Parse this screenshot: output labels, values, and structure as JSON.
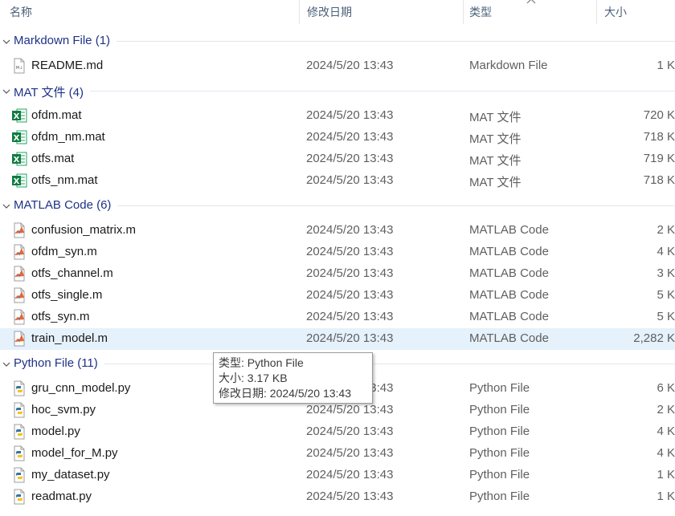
{
  "columns": {
    "name": "名称",
    "date": "修改日期",
    "type": "类型",
    "size": "大小"
  },
  "groups": [
    {
      "title": "Markdown File (1)",
      "files": [
        {
          "name": "README.md",
          "date": "2024/5/20 13:43",
          "type": "Markdown File",
          "size": "1 K",
          "icon": "markdown-file-icon"
        }
      ]
    },
    {
      "title": "MAT 文件 (4)",
      "files": [
        {
          "name": "ofdm.mat",
          "date": "2024/5/20 13:43",
          "type": "MAT 文件",
          "size": "720 K",
          "icon": "excel-mat-file-icon"
        },
        {
          "name": "ofdm_nm.mat",
          "date": "2024/5/20 13:43",
          "type": "MAT 文件",
          "size": "718 K",
          "icon": "excel-mat-file-icon"
        },
        {
          "name": "otfs.mat",
          "date": "2024/5/20 13:43",
          "type": "MAT 文件",
          "size": "719 K",
          "icon": "excel-mat-file-icon"
        },
        {
          "name": "otfs_nm.mat",
          "date": "2024/5/20 13:43",
          "type": "MAT 文件",
          "size": "718 K",
          "icon": "excel-mat-file-icon"
        }
      ]
    },
    {
      "title": "MATLAB Code (6)",
      "files": [
        {
          "name": "confusion_matrix.m",
          "date": "2024/5/20 13:43",
          "type": "MATLAB Code",
          "size": "2 K",
          "icon": "matlab-file-icon"
        },
        {
          "name": "ofdm_syn.m",
          "date": "2024/5/20 13:43",
          "type": "MATLAB Code",
          "size": "4 K",
          "icon": "matlab-file-icon"
        },
        {
          "name": "otfs_channel.m",
          "date": "2024/5/20 13:43",
          "type": "MATLAB Code",
          "size": "3 K",
          "icon": "matlab-file-icon"
        },
        {
          "name": "otfs_single.m",
          "date": "2024/5/20 13:43",
          "type": "MATLAB Code",
          "size": "5 K",
          "icon": "matlab-file-icon"
        },
        {
          "name": "otfs_syn.m",
          "date": "2024/5/20 13:43",
          "type": "MATLAB Code",
          "size": "5 K",
          "icon": "matlab-file-icon"
        },
        {
          "name": "train_model.m",
          "date": "2024/5/20 13:43",
          "type": "MATLAB Code",
          "size": "2,282 K",
          "icon": "matlab-file-icon",
          "selected": true
        }
      ]
    },
    {
      "title": "Python File (11)",
      "files": [
        {
          "name": "gru_cnn_model.py",
          "date": "2024/5/20 13:43",
          "type": "Python File",
          "size": "6 K",
          "icon": "python-file-icon"
        },
        {
          "name": "hoc_svm.py",
          "date": "2024/5/20 13:43",
          "type": "Python File",
          "size": "2 K",
          "icon": "python-file-icon"
        },
        {
          "name": "model.py",
          "date": "2024/5/20 13:43",
          "type": "Python File",
          "size": "4 K",
          "icon": "python-file-icon"
        },
        {
          "name": "model_for_M.py",
          "date": "2024/5/20 13:43",
          "type": "Python File",
          "size": "4 K",
          "icon": "python-file-icon"
        },
        {
          "name": "my_dataset.py",
          "date": "2024/5/20 13:43",
          "type": "Python File",
          "size": "1 K",
          "icon": "python-file-icon"
        },
        {
          "name": "readmat.py",
          "date": "2024/5/20 13:43",
          "type": "Python File",
          "size": "1 K",
          "icon": "python-file-icon"
        }
      ]
    }
  ],
  "tooltip": {
    "line1": "类型: Python File",
    "line2": "大小: 3.17 KB",
    "line3": "修改日期: 2024/5/20 13:43"
  },
  "colors": {
    "group_title": "#1e3287",
    "selection": "#e5f1fb",
    "header_text": "#4c607a"
  }
}
